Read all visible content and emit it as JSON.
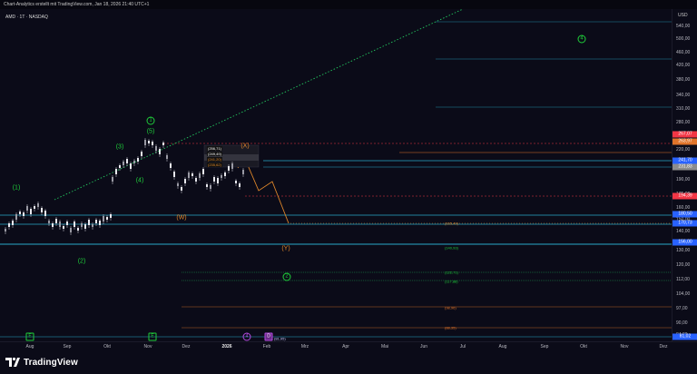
{
  "header": {
    "credit": "Chart-Analytics erstellt mit TradingView.com, Jan 18, 2026 21:40 UTC+1",
    "symbol_line": "AMD · 1T · NASDAQ"
  },
  "price_axis": {
    "currency": "USD",
    "ticks": [
      "540,00",
      "500,00",
      "460,00",
      "420,00",
      "380,00",
      "340,00",
      "310,00",
      "280,00",
      "250,00",
      "220,00",
      "205,00",
      "190,00",
      "175,00",
      "160,00",
      "150,00",
      "140,00",
      "130,00",
      "120,00",
      "112,00",
      "104,00",
      "97,00",
      "90,00",
      "84,00"
    ],
    "badges": [
      {
        "text": "267,07",
        "color": "#f23645"
      },
      {
        "text": "263,97",
        "color": "#e0742a"
      },
      {
        "text": "241,70",
        "color": "#2962ff"
      },
      {
        "text": "231,83",
        "color": "#8c8c8c"
      },
      {
        "text": "194,39",
        "color": "#f23645"
      },
      {
        "text": "180,50",
        "color": "#2962ff"
      },
      {
        "text": "170,73",
        "color": "#2962ff"
      },
      {
        "text": "156,00",
        "color": "#2962ff"
      },
      {
        "text": "81,02",
        "color": "#2962ff"
      }
    ]
  },
  "time_axis": {
    "labels": [
      "Aug",
      "Sep",
      "Okt",
      "Nov",
      "Dez",
      "2026",
      "Feb",
      "Mrz",
      "Apr",
      "Mai",
      "Jun",
      "Jul",
      "Aug",
      "Sep",
      "Okt",
      "Nov",
      "Dez"
    ]
  },
  "waves": {
    "w1": "(1)",
    "w2": "(2)",
    "w3": "(3)",
    "w4": "(4)",
    "w5": "(5)",
    "c1": "1",
    "c2": "2",
    "c4": "4",
    "X": "(X)",
    "W": "(W)",
    "Y": "(Y)"
  },
  "levels": {
    "l1": "(165,49)",
    "l2": "(140,93)",
    "l3": "(122,71)",
    "l4": "(117,88)",
    "l5": "(98,96)",
    "l6": "(88,35)",
    "l7": "(81,95)",
    "box_a": "(256,71)",
    "box_b": "(249,49)",
    "box_c": "(241,20)",
    "box_d": "(235,62)"
  },
  "bottom_tags": {
    "t1": "E",
    "t2": "E",
    "t3": "4",
    "t4": "D"
  },
  "footer": {
    "brand": "TradingView"
  },
  "colors": {
    "bg": "#0b0b18",
    "wave_green": "#1fcf3a",
    "wave_orange": "#e0872a",
    "trend_green": "#22c55e"
  }
}
